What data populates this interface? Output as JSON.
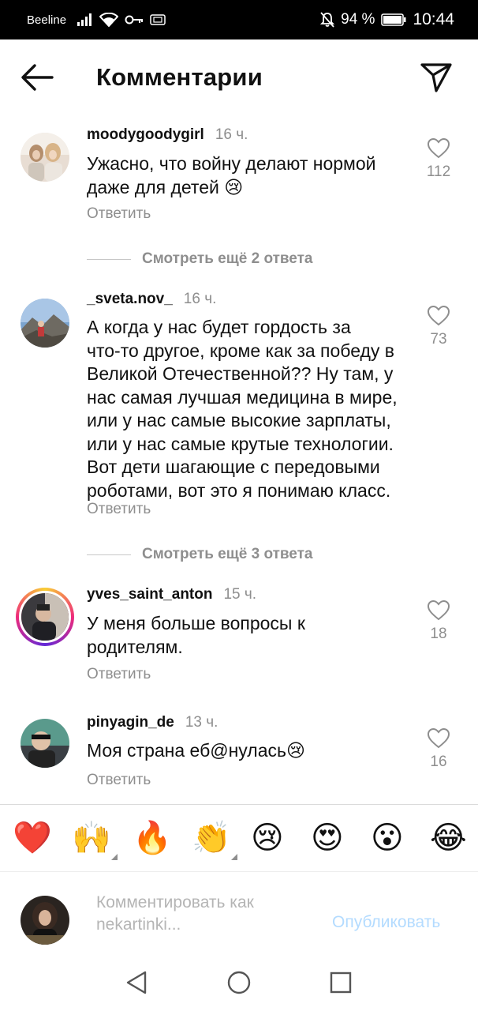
{
  "status_bar": {
    "carrier": "Beeline",
    "battery": "94 %",
    "time": "10:44"
  },
  "header": {
    "title": "Комментарии",
    "back_icon": "arrow-left-icon",
    "send_icon": "paper-plane-icon"
  },
  "comments": [
    {
      "username": "moodygoodygirl",
      "time": "16 ч.",
      "text_lines": [
        "Ужасно, что войну делают нормой",
        "даже для детей 😢"
      ],
      "reply_label": "Ответить",
      "likes": "112"
    },
    {
      "username": "_sveta.nov_",
      "time": "16 ч.",
      "text_lines": [
        "А когда у нас будет гордость за",
        "что-то другое, кроме как за победу в",
        "Великой Отечественной?? Ну там, у",
        "нас самая лучшая медицина в мире,",
        "или у нас самые высокие зарплаты,",
        "или у нас самые крутые технологии.",
        "Вот дети шагающие с передовыми",
        "роботами, вот это я понимаю класс."
      ],
      "reply_label": "Ответить",
      "likes": "73"
    },
    {
      "username": "yves_saint_anton",
      "time": "15 ч.",
      "text_lines": [
        "У меня больше вопросы к",
        "родителям."
      ],
      "reply_label": "Ответить",
      "likes": "18"
    },
    {
      "username": "pinyagin_de",
      "time": "13 ч.",
      "text_lines": [
        "Моя страна еб@нулась😢"
      ],
      "reply_label": "Ответить",
      "likes": "16"
    }
  ],
  "more_replies": [
    "Смотреть ещё 2 ответа",
    "Смотреть ещё 3 ответа"
  ],
  "emoji_bar": [
    "❤️",
    "🙌",
    "🔥",
    "👏",
    "😢",
    "😍",
    "😮",
    "😂"
  ],
  "composer": {
    "placeholder_lines": [
      "Комментировать как",
      "nekartinki..."
    ],
    "publish_label": "Опубликовать"
  },
  "colors": {
    "secondary_text": "#8e8e8e",
    "publish_disabled": "#b3dbff"
  }
}
